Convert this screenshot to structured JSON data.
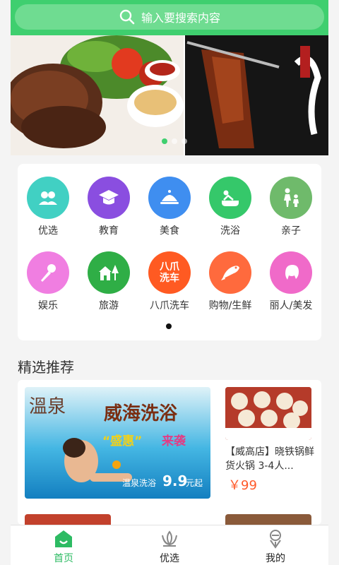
{
  "search": {
    "placeholder": "输入要搜索内容"
  },
  "banner": {
    "slides": 3,
    "active_slide": 0
  },
  "categories": [
    {
      "label": "优选",
      "icon": "users-icon",
      "color": "#41d0c3"
    },
    {
      "label": "教育",
      "icon": "graduation-cap-icon",
      "color": "#8a4ee0"
    },
    {
      "label": "美食",
      "icon": "cloche-icon",
      "color": "#3f8ef0"
    },
    {
      "label": "洗浴",
      "icon": "bath-icon",
      "color": "#35c86a"
    },
    {
      "label": "亲子",
      "icon": "parent-child-icon",
      "color": "#6fba6b"
    },
    {
      "label": "娱乐",
      "icon": "microphone-icon",
      "color": "#f07ee1"
    },
    {
      "label": "旅游",
      "icon": "house-tree-icon",
      "color": "#2fae46"
    },
    {
      "label": "八爪洗车",
      "icon": "car-wash-badge-icon",
      "color": "#ff5a22",
      "badge_text": "八爪\n洗车"
    },
    {
      "label": "购物/生鲜",
      "icon": "fish-icon",
      "color": "#ff6a3d"
    },
    {
      "label": "丽人/美发",
      "icon": "woman-hair-icon",
      "color": "#f06ac9"
    }
  ],
  "recommend": {
    "title": "精选推荐",
    "ad": {
      "brand": "溫泉",
      "headline": "威海洗浴",
      "slogan_a": "“盛惠”",
      "slogan_b": "来袭",
      "price_line": "温泉洗浴",
      "price": "9.9",
      "price_unit": "元起"
    },
    "item": {
      "name": "【威高店】晓铁锅鲜货火锅 3-4人...",
      "price": "￥99"
    }
  },
  "tabs": [
    {
      "label": "首页",
      "icon": "home-icon",
      "active": true
    },
    {
      "label": "优选",
      "icon": "lotus-icon",
      "active": false
    },
    {
      "label": "我的",
      "icon": "profile-icon",
      "active": false
    }
  ],
  "colors": {
    "brand": "#3fcf6f",
    "price": "#ff5a2a",
    "inactive_tab": "#222222"
  }
}
